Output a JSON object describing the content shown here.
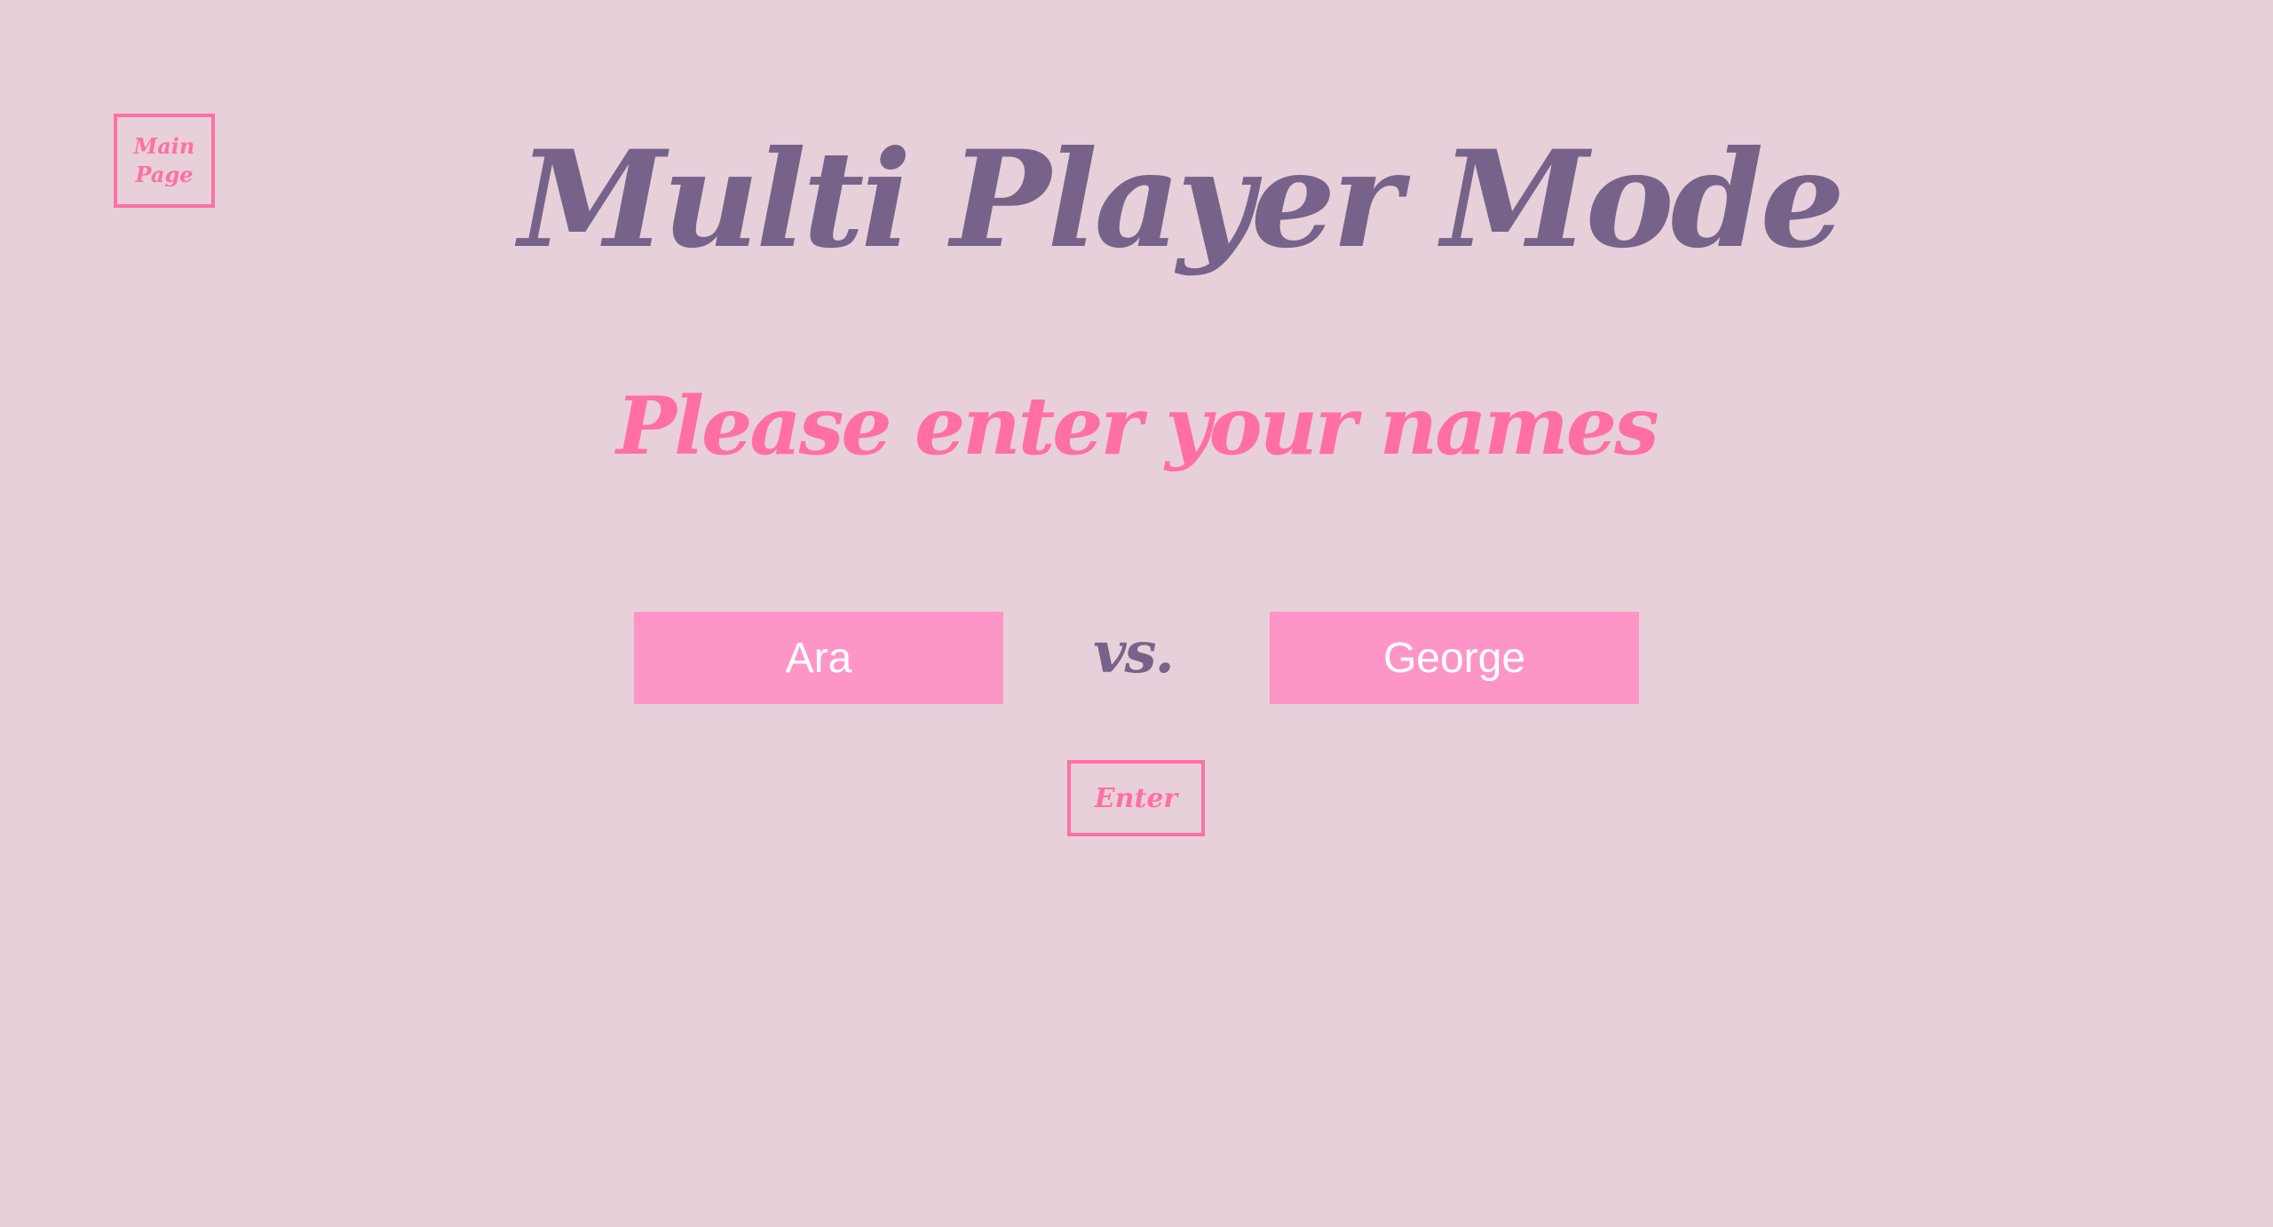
{
  "nav": {
    "main_page_label": "Main Page"
  },
  "header": {
    "title": "Multi Player Mode",
    "subtitle": "Please enter your names"
  },
  "form": {
    "player1_value": "Ara",
    "player2_value": "George",
    "vs_label": "vs.",
    "enter_label": "Enter"
  },
  "colors": {
    "background": "#e7d0d9",
    "title": "#77638a",
    "accent": "#ff6fa5",
    "input_fill": "#fd96c6",
    "input_text": "#ffffff"
  }
}
